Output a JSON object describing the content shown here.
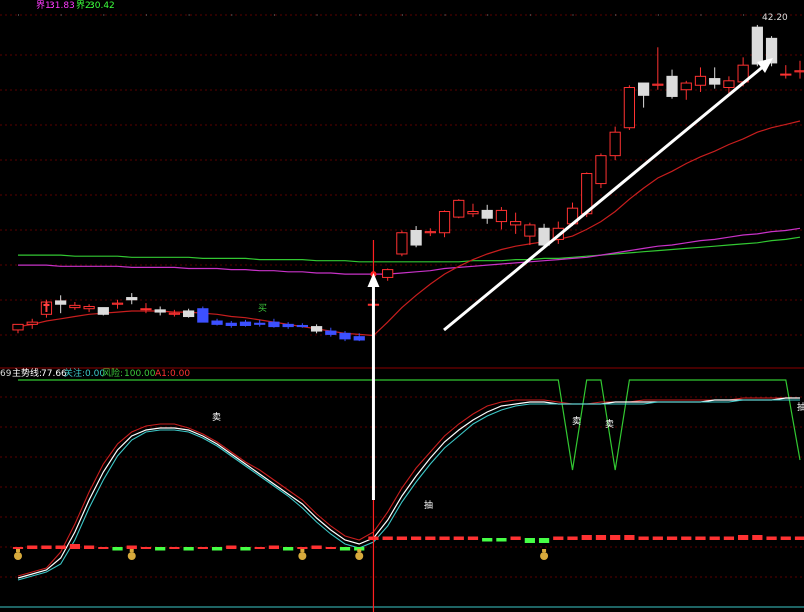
{
  "top_legend": {
    "b1_label": "界1:",
    "b1_value": "31.83",
    "b1_color": "#ff3cff",
    "b2_label": "界2:",
    "b2_value": "30.42",
    "b2_color": "#3cff3c"
  },
  "price_max_label": "42.20",
  "mid_legend": {
    "prefix": "69",
    "trend_label": "主势线:",
    "trend_value": "77.66",
    "focus_label": "关注:",
    "focus_value": "0.00",
    "risk_label": "风险:",
    "risk_value": "100.00",
    "a1_label": "A1:",
    "a1_value": "0.00"
  },
  "annotations": {
    "buy_char_1": "买",
    "sell_char_1": "卖",
    "sell_char_2": "卖",
    "sell_char_3": "卖",
    "sell_char_4": "抽",
    "bottom_char": "抽"
  },
  "colors": {
    "up": "#ff3232",
    "down_blue": "#3c50ff",
    "down_white": "#dcdcdc",
    "ma_red": "#c81e1e",
    "ma_green": "#32c832",
    "ma_magenta": "#c832c8",
    "grid": "#5a0000",
    "white_line": "#ffffff",
    "cyan_line": "#3cc8c8",
    "green_osc": "#46ff46",
    "bag_icon": "#d7aa3c"
  },
  "chart_data": {
    "type": "candlestick",
    "title": "",
    "panels": [
      "price",
      "indicator"
    ],
    "price_ylim": [
      14.0,
      43.0
    ],
    "candles": [
      {
        "o": 14.9,
        "h": 15.4,
        "l": 14.6,
        "c": 15.4,
        "dir": "up"
      },
      {
        "o": 15.4,
        "h": 15.9,
        "l": 15.0,
        "c": 15.6,
        "dir": "up"
      },
      {
        "o": 16.3,
        "h": 17.6,
        "l": 16.0,
        "c": 17.4,
        "dir": "up"
      },
      {
        "o": 17.2,
        "h": 18.0,
        "l": 16.4,
        "c": 17.5,
        "dir": "down_white"
      },
      {
        "o": 17.1,
        "h": 17.4,
        "l": 16.7,
        "c": 16.9,
        "dir": "up"
      },
      {
        "o": 16.8,
        "h": 17.2,
        "l": 16.5,
        "c": 17.0,
        "dir": "up"
      },
      {
        "o": 16.9,
        "h": 16.9,
        "l": 16.2,
        "c": 16.3,
        "dir": "down_white"
      },
      {
        "o": 17.2,
        "h": 17.6,
        "l": 16.8,
        "c": 17.3,
        "dir": "up"
      },
      {
        "o": 17.6,
        "h": 18.2,
        "l": 17.2,
        "c": 17.8,
        "dir": "down_white"
      },
      {
        "o": 16.8,
        "h": 17.3,
        "l": 16.4,
        "c": 16.8,
        "dir": "up"
      },
      {
        "o": 16.7,
        "h": 17.0,
        "l": 16.2,
        "c": 16.5,
        "dir": "down_white"
      },
      {
        "o": 16.4,
        "h": 16.7,
        "l": 16.1,
        "c": 16.3,
        "dir": "up"
      },
      {
        "o": 16.6,
        "h": 16.8,
        "l": 16.0,
        "c": 16.1,
        "dir": "down_white"
      },
      {
        "o": 16.8,
        "h": 17.0,
        "l": 15.6,
        "c": 15.6,
        "dir": "down_blue"
      },
      {
        "o": 15.7,
        "h": 15.9,
        "l": 15.3,
        "c": 15.4,
        "dir": "down_blue"
      },
      {
        "o": 15.5,
        "h": 15.7,
        "l": 15.1,
        "c": 15.3,
        "dir": "down_blue"
      },
      {
        "o": 15.6,
        "h": 15.8,
        "l": 15.2,
        "c": 15.3,
        "dir": "down_blue"
      },
      {
        "o": 15.5,
        "h": 15.8,
        "l": 15.2,
        "c": 15.4,
        "dir": "down_blue"
      },
      {
        "o": 15.6,
        "h": 15.9,
        "l": 15.1,
        "c": 15.2,
        "dir": "down_blue"
      },
      {
        "o": 15.4,
        "h": 15.6,
        "l": 15.0,
        "c": 15.2,
        "dir": "down_blue"
      },
      {
        "o": 15.3,
        "h": 15.5,
        "l": 15.1,
        "c": 15.2,
        "dir": "down_blue"
      },
      {
        "o": 15.2,
        "h": 15.4,
        "l": 14.6,
        "c": 14.8,
        "dir": "down_white"
      },
      {
        "o": 14.8,
        "h": 15.1,
        "l": 14.3,
        "c": 14.5,
        "dir": "down_blue"
      },
      {
        "o": 14.6,
        "h": 14.8,
        "l": 13.9,
        "c": 14.1,
        "dir": "down_blue"
      },
      {
        "o": 14.3,
        "h": 14.6,
        "l": 13.9,
        "c": 14.0,
        "dir": "down_blue"
      },
      {
        "o": 17.2,
        "h": 17.2,
        "l": 17.1,
        "c": 17.2,
        "dir": "up"
      },
      {
        "o": 19.6,
        "h": 20.4,
        "l": 19.3,
        "c": 20.3,
        "dir": "up"
      },
      {
        "o": 21.7,
        "h": 23.8,
        "l": 21.5,
        "c": 23.6,
        "dir": "up"
      },
      {
        "o": 22.5,
        "h": 24.2,
        "l": 22.3,
        "c": 23.8,
        "dir": "down_white"
      },
      {
        "o": 23.7,
        "h": 24.0,
        "l": 23.3,
        "c": 23.6,
        "dir": "up"
      },
      {
        "o": 23.6,
        "h": 25.6,
        "l": 23.2,
        "c": 25.5,
        "dir": "up"
      },
      {
        "o": 25.0,
        "h": 26.6,
        "l": 24.9,
        "c": 26.5,
        "dir": "up"
      },
      {
        "o": 25.5,
        "h": 26.2,
        "l": 25.0,
        "c": 25.3,
        "dir": "up"
      },
      {
        "o": 25.6,
        "h": 26.1,
        "l": 24.4,
        "c": 24.9,
        "dir": "down_white"
      },
      {
        "o": 24.6,
        "h": 25.9,
        "l": 23.9,
        "c": 25.6,
        "dir": "up"
      },
      {
        "o": 24.6,
        "h": 25.4,
        "l": 23.5,
        "c": 24.3,
        "dir": "up"
      },
      {
        "o": 23.3,
        "h": 24.5,
        "l": 22.5,
        "c": 24.3,
        "dir": "up"
      },
      {
        "o": 22.5,
        "h": 24.4,
        "l": 22.2,
        "c": 24.0,
        "dir": "down_white"
      },
      {
        "o": 23.0,
        "h": 24.6,
        "l": 22.6,
        "c": 24.0,
        "dir": "up"
      },
      {
        "o": 24.4,
        "h": 26.3,
        "l": 24.2,
        "c": 25.8,
        "dir": "up"
      },
      {
        "o": 25.3,
        "h": 29.0,
        "l": 25.0,
        "c": 28.9,
        "dir": "up"
      },
      {
        "o": 28.0,
        "h": 30.7,
        "l": 27.6,
        "c": 30.5,
        "dir": "up"
      },
      {
        "o": 30.5,
        "h": 33.1,
        "l": 30.1,
        "c": 32.6,
        "dir": "up"
      },
      {
        "o": 33.0,
        "h": 36.8,
        "l": 32.8,
        "c": 36.6,
        "dir": "up"
      },
      {
        "o": 35.9,
        "h": 37.0,
        "l": 34.8,
        "c": 37.0,
        "dir": "down_white"
      },
      {
        "o": 36.9,
        "h": 40.2,
        "l": 36.4,
        "c": 36.8,
        "dir": "up"
      },
      {
        "o": 37.6,
        "h": 38.2,
        "l": 35.6,
        "c": 35.8,
        "dir": "down_white"
      },
      {
        "o": 36.4,
        "h": 37.2,
        "l": 35.5,
        "c": 37.0,
        "dir": "up"
      },
      {
        "o": 36.8,
        "h": 38.4,
        "l": 36.2,
        "c": 37.6,
        "dir": "up"
      },
      {
        "o": 37.4,
        "h": 38.4,
        "l": 36.5,
        "c": 36.9,
        "dir": "down_white"
      },
      {
        "o": 36.6,
        "h": 37.6,
        "l": 36.1,
        "c": 37.2,
        "dir": "up"
      },
      {
        "o": 37.1,
        "h": 39.3,
        "l": 36.7,
        "c": 38.6,
        "dir": "up"
      },
      {
        "o": 38.7,
        "h": 42.2,
        "l": 38.5,
        "c": 42.0,
        "dir": "down_white"
      },
      {
        "o": 41.0,
        "h": 41.2,
        "l": 38.5,
        "c": 38.8,
        "dir": "down_white"
      },
      {
        "o": 37.8,
        "h": 38.6,
        "l": 37.4,
        "c": 37.8,
        "dir": "up"
      },
      {
        "o": 38.0,
        "h": 39.0,
        "l": 37.4,
        "c": 38.1,
        "dir": "up"
      }
    ],
    "ma_red": [
      15.2,
      15.4,
      15.7,
      15.9,
      16.1,
      16.3,
      16.4,
      16.5,
      16.6,
      16.6,
      16.6,
      16.5,
      16.5,
      16.4,
      16.3,
      16.1,
      16.0,
      15.8,
      15.6,
      15.4,
      15.2,
      15.0,
      14.8,
      14.6,
      14.5,
      14.4,
      15.6,
      16.9,
      18.0,
      19.0,
      19.9,
      20.6,
      21.2,
      21.7,
      22.1,
      22.4,
      22.6,
      22.8,
      23.0,
      23.3,
      23.9,
      24.6,
      25.5,
      26.6,
      27.6,
      28.5,
      29.1,
      29.8,
      30.4,
      30.9,
      31.5,
      32.0,
      32.6,
      33.0,
      33.3,
      33.6
    ],
    "ma_green": [
      21.6,
      21.6,
      21.6,
      21.6,
      21.5,
      21.5,
      21.5,
      21.5,
      21.4,
      21.4,
      21.4,
      21.4,
      21.4,
      21.3,
      21.3,
      21.3,
      21.3,
      21.2,
      21.2,
      21.2,
      21.2,
      21.1,
      21.1,
      21.1,
      21.0,
      21.0,
      21.0,
      21.0,
      21.0,
      21.0,
      21.0,
      21.0,
      21.1,
      21.1,
      21.1,
      21.2,
      21.2,
      21.3,
      21.3,
      21.4,
      21.5,
      21.6,
      21.7,
      21.8,
      21.9,
      22.0,
      22.1,
      22.2,
      22.3,
      22.4,
      22.5,
      22.6,
      22.7,
      22.9,
      23.0,
      23.2
    ],
    "ma_magenta": [
      20.7,
      20.7,
      20.7,
      20.6,
      20.6,
      20.6,
      20.6,
      20.6,
      20.5,
      20.5,
      20.5,
      20.5,
      20.4,
      20.4,
      20.4,
      20.3,
      20.3,
      20.2,
      20.2,
      20.1,
      20.1,
      20.0,
      20.0,
      19.9,
      19.9,
      19.9,
      19.9,
      20.0,
      20.1,
      20.2,
      20.4,
      20.5,
      20.6,
      20.7,
      20.8,
      20.9,
      21.0,
      21.1,
      21.2,
      21.3,
      21.4,
      21.6,
      21.8,
      22.0,
      22.2,
      22.4,
      22.5,
      22.7,
      22.9,
      23.0,
      23.2,
      23.4,
      23.5,
      23.7,
      23.8,
      24.0
    ],
    "osc_ylim": [
      0,
      100
    ],
    "osc_red": [
      2,
      4,
      6,
      14,
      28,
      44,
      58,
      68,
      74,
      77,
      78,
      78,
      76,
      73,
      69,
      64,
      59,
      55,
      50,
      45,
      40,
      33,
      27,
      22,
      20,
      24,
      34,
      46,
      56,
      64,
      72,
      78,
      83,
      87,
      89,
      90,
      90,
      90,
      89,
      88,
      88,
      89,
      89,
      89,
      90,
      90,
      90,
      90,
      90,
      90,
      90,
      91,
      91,
      91,
      91,
      91
    ],
    "osc_white": [
      1,
      3,
      5,
      11,
      24,
      40,
      54,
      65,
      72,
      75,
      76,
      76,
      75,
      72,
      68,
      63,
      58,
      53,
      48,
      43,
      38,
      31,
      25,
      20,
      18,
      21,
      30,
      42,
      52,
      61,
      69,
      75,
      80,
      84,
      87,
      88,
      89,
      89,
      88,
      88,
      88,
      88,
      89,
      89,
      89,
      89,
      89,
      89,
      89,
      90,
      90,
      90,
      90,
      90,
      91,
      91
    ],
    "osc_cyan": [
      0,
      2,
      4,
      8,
      20,
      36,
      50,
      62,
      70,
      74,
      75,
      75,
      74,
      71,
      67,
      62,
      57,
      52,
      47,
      42,
      36,
      29,
      23,
      18,
      16,
      19,
      27,
      39,
      49,
      58,
      66,
      72,
      78,
      82,
      85,
      87,
      88,
      88,
      88,
      88,
      88,
      88,
      88,
      88,
      88,
      89,
      89,
      89,
      89,
      89,
      89,
      90,
      90,
      90,
      90,
      90
    ],
    "osc_green_steps": [
      100,
      100,
      100,
      100,
      100,
      100,
      100,
      100,
      100,
      100,
      100,
      100,
      100,
      100,
      100,
      100,
      100,
      100,
      100,
      100,
      100,
      100,
      100,
      100,
      100,
      100,
      100,
      100,
      100,
      100,
      100,
      100,
      100,
      100,
      100,
      100,
      100,
      100,
      100,
      55,
      100,
      100,
      55,
      100,
      100,
      100,
      100,
      100,
      100,
      100,
      100,
      100,
      100,
      100,
      100,
      60
    ],
    "bottom_bars": [
      0,
      1,
      1,
      1,
      2,
      1,
      0,
      -1,
      1,
      0,
      -1,
      0,
      -1,
      0,
      -1,
      1,
      -1,
      0,
      1,
      -1,
      0,
      1,
      0,
      -1,
      -1,
      1,
      1,
      1,
      1,
      1,
      1,
      1,
      1,
      -1,
      -1,
      1,
      -2,
      -2,
      1,
      1,
      2,
      2,
      2,
      2,
      1,
      1,
      1,
      1,
      1,
      1,
      1,
      2,
      2,
      1,
      1,
      1
    ],
    "signal_bags_idx": [
      0,
      8,
      20,
      24,
      37
    ],
    "mark_candle_idx": 25
  }
}
